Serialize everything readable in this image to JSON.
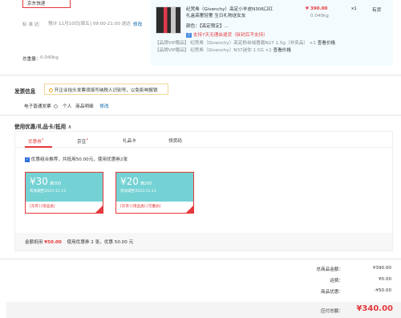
{
  "shipping": {
    "courier": "京东快递",
    "label": "标  准  达：",
    "time": "预计 11月10日[周五] 09:00-21:00 送达",
    "modify": "修改",
    "weight_label": "总重量：",
    "weight": "0.040kg"
  },
  "product": {
    "name": "纪梵希（Givenchy）高定小羊皮N306口红礼盒高奢轻奢 生日礼物送女友",
    "price": "¥ 390.00",
    "qty": "x1",
    "stock": "有货",
    "weight": "0.040kg",
    "color_label": "颜色：",
    "color": "【高定限定】...",
    "support": "支持7天无理由退货（拆封后不支持）",
    "gifts": [
      {
        "tag": "【品牌VIP赠品】",
        "name": "纪梵希（Givenchy）高定粉丝绒唇霜N27 1.5g（非卖品）",
        "qty": "×1",
        "link": "查看价格"
      },
      {
        "tag": "【品牌VIP赠品】",
        "name": "纪梵希（Givenchy）N37迷你 1.5G ×1",
        "qty": "",
        "link": "查看价格"
      }
    ]
  },
  "invoice": {
    "title": "发票信息",
    "tip": "开企业抬头发票须填写纳税人识别号，以免影响报销",
    "type": "电子普通发票",
    "person": "个人",
    "detail": "商品明细",
    "modify": "修改"
  },
  "coupons": {
    "title": "使用优惠/礼品卡/抵用",
    "tabs": [
      "优惠券",
      "京豆",
      "礼品卡",
      "领货码"
    ],
    "recommend": "优惠组合推荐，共抵用50.00元，使用优惠券2张",
    "cards": [
      {
        "amount": "¥30",
        "cond": "满300",
        "expiry": "有效期至2023-11-13",
        "tags": "[东券] [限品类]"
      },
      {
        "amount": "¥20",
        "cond": "满200",
        "expiry": "有效期至2023-11-11",
        "tags": "[东券] [限品类] [可叠加]"
      }
    ],
    "summary_prefix": "金额抵用",
    "summary_amount": "¥50.00",
    "summary_suffix": "使用优惠券 2 张，优惠 50.00 元"
  },
  "totals": {
    "goods_label": "总商品金额：",
    "goods": "¥390.00",
    "freight_label": "运费：",
    "freight": "¥0.00",
    "discount_label": "商品优惠：",
    "discount": "-¥50.00",
    "payable_label": "应付总额：",
    "payable": "¥340.00"
  },
  "colors": {
    "accent": "#e4393c",
    "coupon": "#74d2d4",
    "link": "#005ea7"
  }
}
